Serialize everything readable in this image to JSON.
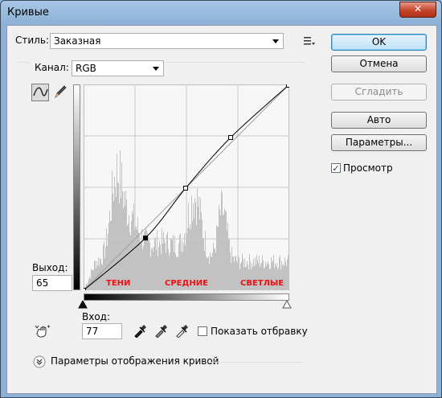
{
  "window": {
    "title": "Кривые",
    "close_symbol": "✕"
  },
  "style": {
    "label": "Стиль:",
    "value": "Заказная"
  },
  "channel": {
    "label": "Канал:",
    "value": "RGB"
  },
  "buttons": {
    "ok": "OK",
    "cancel": "Отмена",
    "smooth": "Сгладить",
    "auto": "Авто",
    "options": "Параметры..."
  },
  "preview": {
    "label": "Просмотр",
    "checked": true
  },
  "output": {
    "label": "Выход:",
    "value": "65"
  },
  "input": {
    "label": "Вход:",
    "value": "77"
  },
  "clipping": {
    "label": "Показать отбравку",
    "checked": false
  },
  "curve_display": {
    "label": "Параметры отображения кривой"
  },
  "zones": {
    "shadows": "ТЕНИ",
    "midtones": "СРЕДНИЕ",
    "highlights": "СВЕТЛЫЕ"
  },
  "colors": {
    "zone_text": "#ee1111",
    "ok_border": "#3c7fb1"
  },
  "icons": {
    "style_menu": "preset-options-icon",
    "curve_tool": "curve-points-icon",
    "pencil_tool": "pencil-icon",
    "hand_tool": "on-image-adjust-icon",
    "eyedropper_black": "black-eyedropper-icon",
    "eyedropper_gray": "gray-eyedropper-icon",
    "eyedropper_white": "white-eyedropper-icon",
    "expand": "chevron-expand-icon"
  },
  "curve": {
    "points": [
      [
        0,
        0
      ],
      [
        77,
        65
      ],
      [
        127,
        127
      ],
      [
        183,
        190
      ],
      [
        255,
        255
      ]
    ],
    "selected_point": [
      77,
      65
    ]
  }
}
